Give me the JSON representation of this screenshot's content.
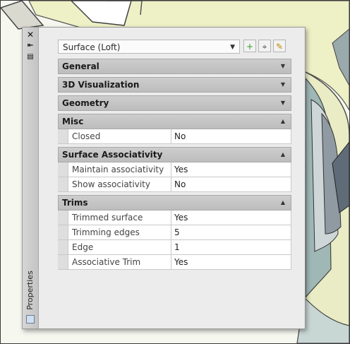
{
  "palette": {
    "title": "Properties",
    "selector": {
      "value": "Surface (Loft)"
    },
    "categories": [
      {
        "name": "General",
        "expanded": false,
        "rows": []
      },
      {
        "name": "3D Visualization",
        "expanded": false,
        "rows": []
      },
      {
        "name": "Geometry",
        "expanded": false,
        "rows": []
      },
      {
        "name": "Misc",
        "expanded": true,
        "rows": [
          {
            "name": "Closed",
            "value": "No"
          }
        ]
      },
      {
        "name": "Surface Associativity",
        "expanded": true,
        "rows": [
          {
            "name": "Maintain associativity",
            "value": "Yes"
          },
          {
            "name": "Show associativity",
            "value": "No"
          }
        ]
      },
      {
        "name": "Trims",
        "expanded": true,
        "rows": [
          {
            "name": "Trimmed surface",
            "value": "Yes"
          },
          {
            "name": "Trimming edges",
            "value": "5"
          },
          {
            "name": "Edge",
            "value": "1"
          },
          {
            "name": "Associative Trim",
            "value": "Yes"
          }
        ]
      }
    ]
  },
  "colors": {
    "viewport_bg": "#f6f7ef",
    "model_fill": "#eef0c6",
    "model_edge": "#555555",
    "accent_teal": "#7da3a0"
  },
  "icons": {
    "close": "close-icon",
    "autohide": "autohide-icon",
    "menu": "properties-menu-icon",
    "quick_select": "quick-select-icon",
    "select_objects": "select-objects-icon",
    "pickadd": "pickadd-toggle-icon"
  }
}
